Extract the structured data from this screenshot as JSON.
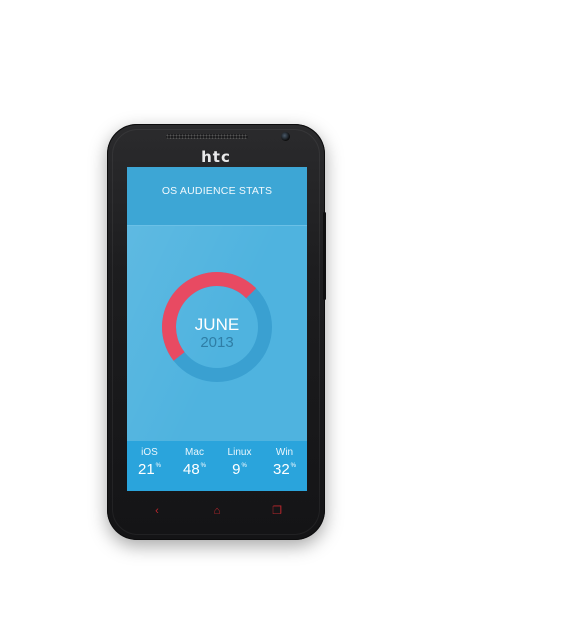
{
  "device": {
    "brand": "htc"
  },
  "app": {
    "title": "OS AUDIENCE STATS",
    "period": {
      "month": "JUNE",
      "year": "2013"
    },
    "donut": {
      "highlight_value": 48,
      "highlight_unit": "percent"
    },
    "stats": [
      {
        "label": "iOS",
        "value": "21",
        "unit": "%"
      },
      {
        "label": "Mac",
        "value": "48",
        "unit": "%"
      },
      {
        "label": "Linux",
        "value": "9",
        "unit": "%"
      },
      {
        "label": "Win",
        "value": "32",
        "unit": "%"
      }
    ]
  },
  "nav": {
    "back_icon": "‹",
    "home_icon": "⌂",
    "recent_icon": "❐"
  },
  "colors": {
    "screen_bg": "#4fb3df",
    "header_bg": "#3da6d5",
    "stats_bg": "#2aa4dc",
    "ring_track": "#3aa0d1",
    "ring_accent": "#e84a62",
    "nav_icon": "#c0272d"
  }
}
